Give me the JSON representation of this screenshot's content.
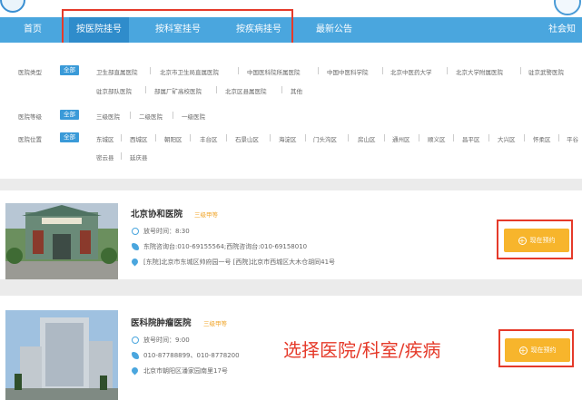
{
  "nav": {
    "items": [
      "首页",
      "按医院挂号",
      "按科室挂号",
      "按疾病挂号",
      "最新公告",
      "社会知"
    ]
  },
  "filters": {
    "type_label": "医院类型",
    "all_label": "全部",
    "type_row1": [
      "卫生部直属医院",
      "北京市卫生局直属医院",
      "中国医科院所属医院",
      "中国中医科学院",
      "北京中医药大学",
      "北京大学附属医院",
      "驻京武警医院"
    ],
    "type_row2": [
      "驻京部队医院",
      "部属厂矿高校医院",
      "北京区县属医院",
      "其他"
    ],
    "level_label": "医院等级",
    "levels": [
      "三级医院",
      "二级医院",
      "一级医院"
    ],
    "location_label": "医院位置",
    "districts_row1": [
      "东城区",
      "西城区",
      "朝阳区",
      "丰台区",
      "石景山区",
      "海淀区",
      "门头沟区",
      "房山区",
      "通州区",
      "顺义区",
      "昌平区",
      "大兴区",
      "怀柔区",
      "平谷"
    ],
    "districts_row2": [
      "密云县",
      "延庆县"
    ]
  },
  "hospitals": [
    {
      "name": "北京协和医院",
      "grade": "三级甲等",
      "release_time": "放号时间：8:30",
      "phone": "东院咨询台:010-69155564;西院咨询台:010-69158010",
      "address": "[东院]北京市东城区帅府园一号 [西院]北京市西城区大木仓胡同41号",
      "book_label": "现在预约"
    },
    {
      "name": "医科院肿瘤医院",
      "grade": "三级甲等",
      "release_time": "放号时间：9:00",
      "phone": "010-87788899、010-8778200",
      "address": "北京市朝阳区潘家园南里17号",
      "book_label": "现在预约"
    }
  ],
  "annotation": "选择医院/科室/疾病",
  "colors": {
    "nav": "#4aa6de",
    "nav_active": "#2f8ccb",
    "highlight": "#e53a2a",
    "button": "#f7b52c",
    "grade": "#f0a52a"
  }
}
